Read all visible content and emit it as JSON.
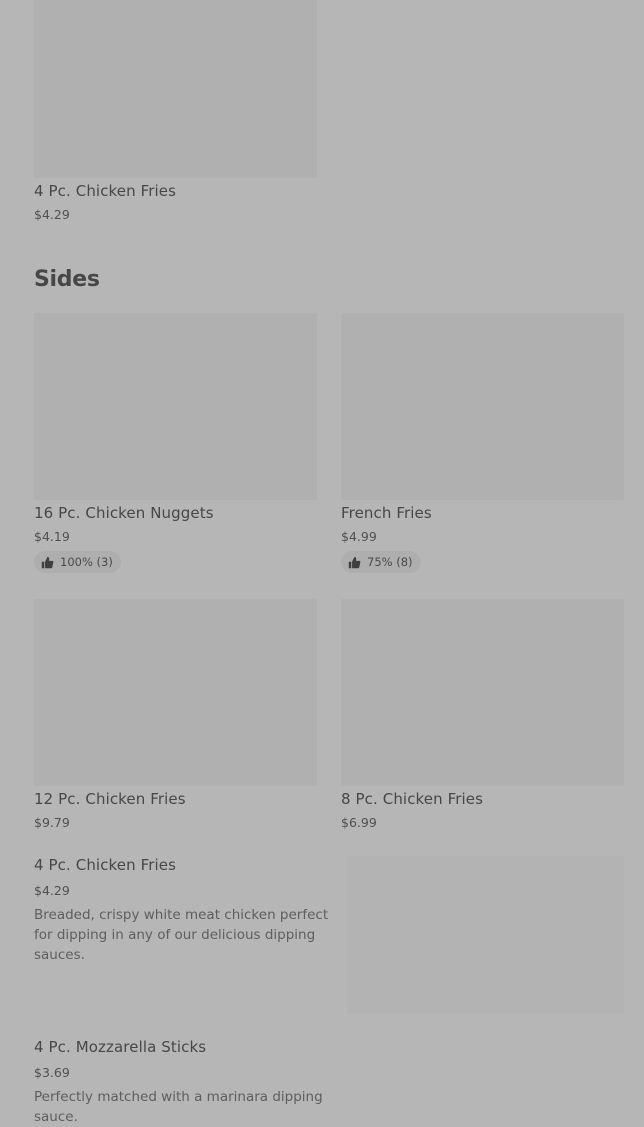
{
  "top_item": {
    "name": "4 Pc. Chicken Fries",
    "price": "$4.29"
  },
  "sides": {
    "heading": "Sides",
    "cards": [
      {
        "name": "16 Pc. Chicken Nuggets",
        "price": "$4.19",
        "rating": "100% (3)",
        "icon": "thumbs-up-icon"
      },
      {
        "name": "French Fries",
        "price": "$4.99",
        "rating": "75% (8)",
        "icon": "thumbs-up-icon"
      },
      {
        "name": "12 Pc. Chicken Fries",
        "price": "$9.79"
      },
      {
        "name": "8 Pc. Chicken Fries",
        "price": "$6.99"
      }
    ],
    "list": [
      {
        "name": "4 Pc. Chicken Fries",
        "price": "$4.29",
        "description": "Breaded, crispy white meat chicken perfect for dipping in any of our delicious dipping sauces."
      },
      {
        "name": "4 Pc. Mozzarella Sticks",
        "price": "$3.69",
        "description": "Perfectly matched with a marinara dipping sauce."
      }
    ]
  },
  "colors": {
    "overlay_background": "#b6b6b6",
    "image_placeholder": "#b0b0b0",
    "text": "#404040"
  }
}
